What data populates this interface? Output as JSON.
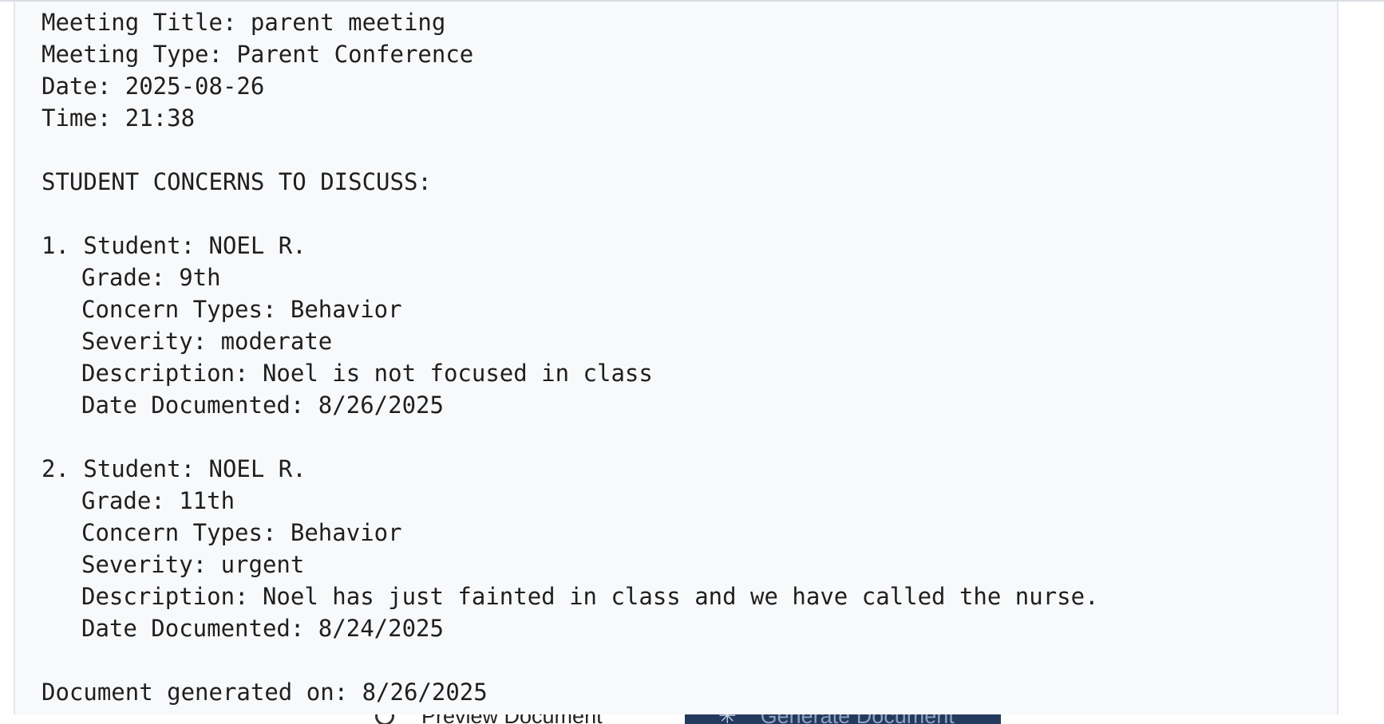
{
  "background": {
    "preview_button_label": "Preview Document",
    "generate_button_label": "Generate Document"
  },
  "document": {
    "meeting_title": "Meeting Title: parent meeting",
    "meeting_type": "Meeting Type: Parent Conference",
    "date": "Date: 2025-08-26",
    "time": "Time: 21:38",
    "section_heading": "STUDENT CONCERNS TO DISCUSS:",
    "concerns": [
      {
        "student": "1. Student: NOEL R.",
        "grade": "Grade: 9th",
        "concern_types": "Concern Types: Behavior",
        "severity": "Severity: moderate",
        "description": "Description: Noel is not focused in class",
        "date_documented": "Date Documented: 8/26/2025"
      },
      {
        "student": "2. Student: NOEL R.",
        "grade": "Grade: 11th",
        "concern_types": "Concern Types: Behavior",
        "severity": "Severity: urgent",
        "description": "Description: Noel has just fainted in class and we have called the nurse.",
        "date_documented": "Date Documented: 8/24/2025"
      }
    ],
    "footer": "Document generated on: 8/26/2025"
  }
}
